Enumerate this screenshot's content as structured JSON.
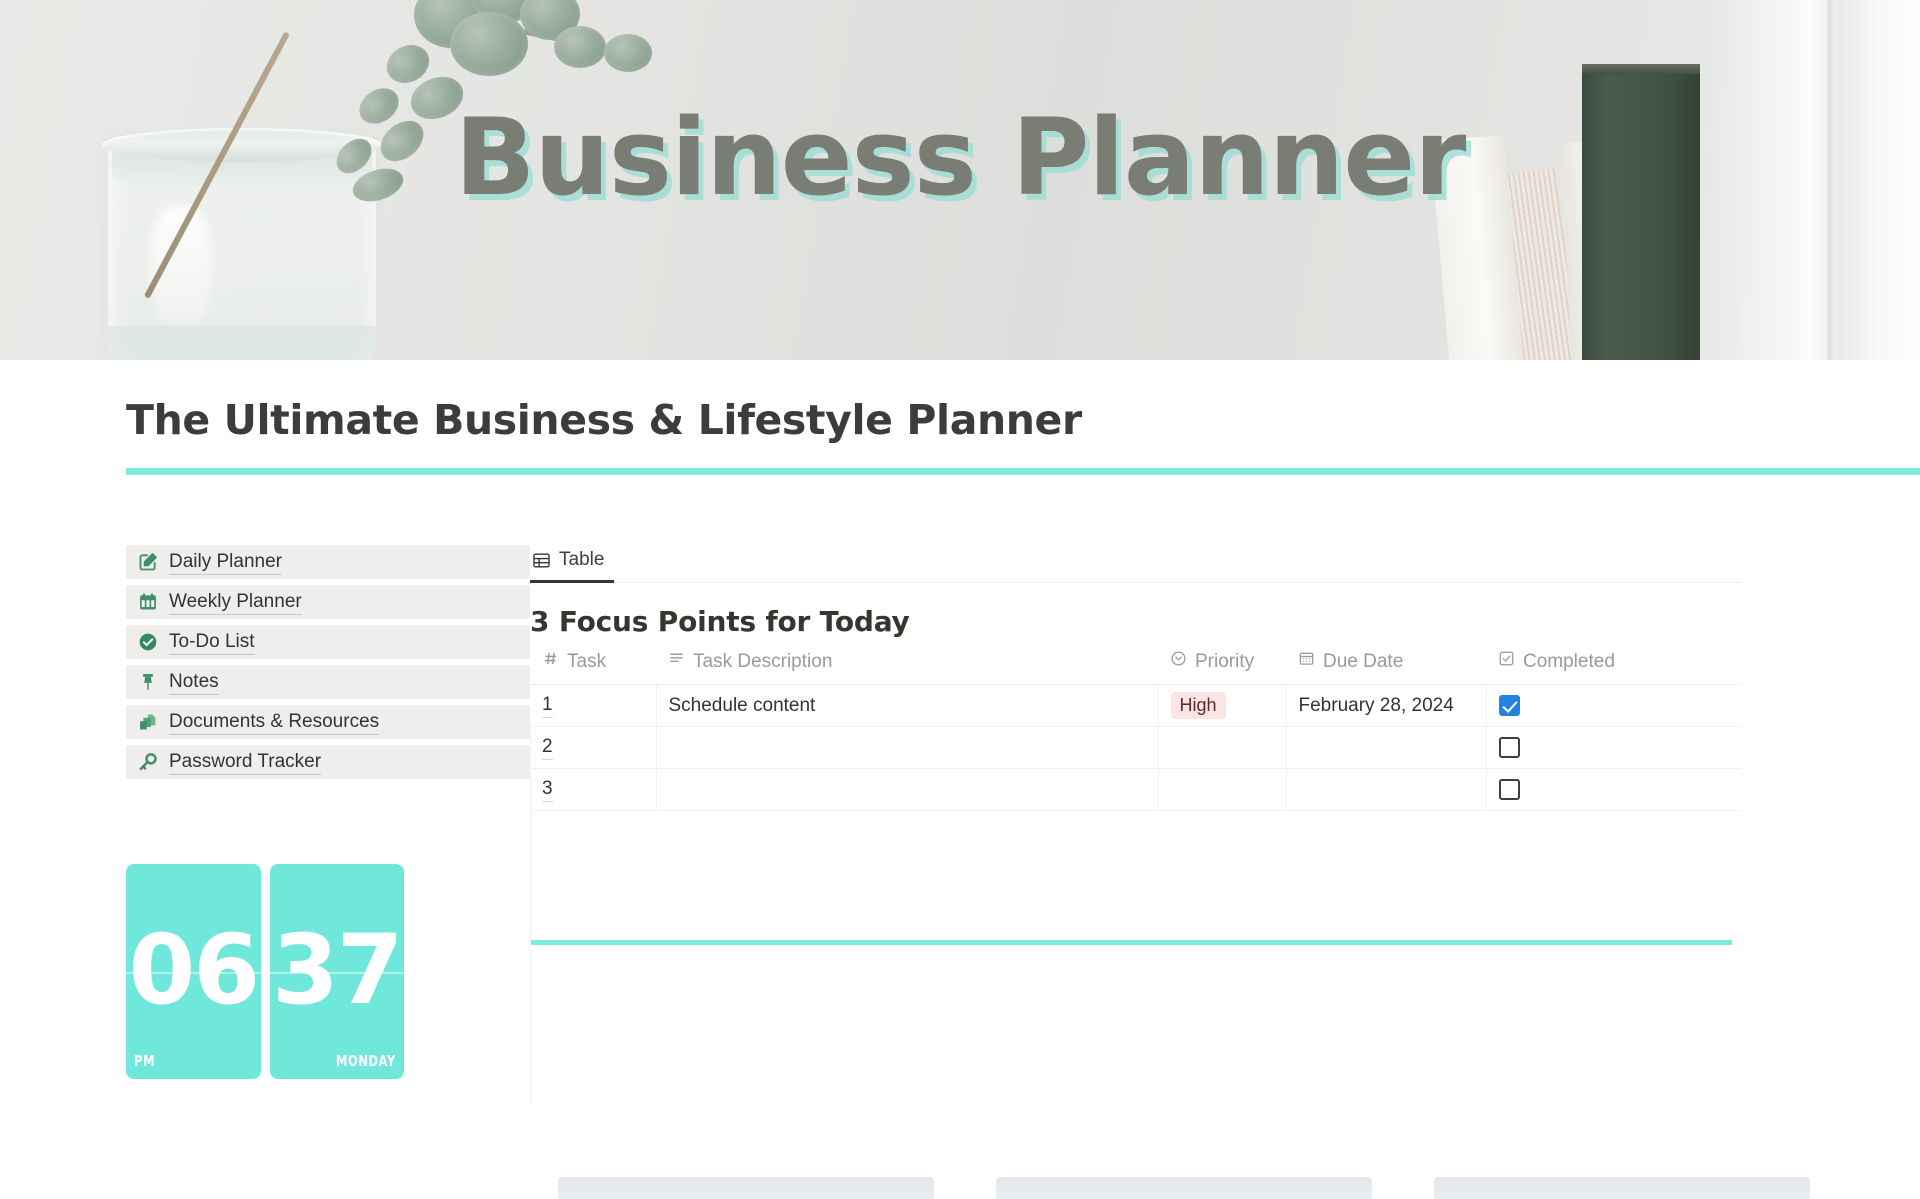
{
  "banner": {
    "title": "Business Planner",
    "title_color": "#797d73",
    "shadow_color": "#96dcd4"
  },
  "page": {
    "title": "The Ultimate Business & Lifestyle Planner",
    "accent_color": "#7cecdd"
  },
  "sidebar": {
    "items": [
      {
        "label": "Daily Planner",
        "icon": "pencil-square-icon"
      },
      {
        "label": "Weekly Planner",
        "icon": "calendar-icon"
      },
      {
        "label": "To-Do List",
        "icon": "check-circle-icon"
      },
      {
        "label": "Notes",
        "icon": "pushpin-icon"
      },
      {
        "label": "Documents & Resources",
        "icon": "documents-icon"
      },
      {
        "label": "Password Tracker",
        "icon": "key-icon"
      }
    ]
  },
  "clock": {
    "hours": "06",
    "minutes": "37",
    "meridiem": "PM",
    "weekday": "MONDAY",
    "color": "#70e7db"
  },
  "main": {
    "tabs": [
      {
        "label": "Table",
        "icon": "table-icon",
        "active": true
      }
    ],
    "database": {
      "title": "3 Focus Points for Today",
      "columns": [
        {
          "label": "Task",
          "icon": "hash-icon"
        },
        {
          "label": "Task Description",
          "icon": "text-lines-icon"
        },
        {
          "label": "Priority",
          "icon": "select-circle-icon"
        },
        {
          "label": "Due Date",
          "icon": "calendar-small-icon"
        },
        {
          "label": "Completed",
          "icon": "checkbox-icon"
        }
      ],
      "rows": [
        {
          "task": "1",
          "description": "Schedule content",
          "priority": "High",
          "priority_bg": "#fbe4e4",
          "priority_fg": "#5d2929",
          "due_date": "February 28, 2024",
          "completed": true
        },
        {
          "task": "2",
          "description": "",
          "priority": "",
          "due_date": "",
          "completed": false
        },
        {
          "task": "3",
          "description": "",
          "priority": "",
          "due_date": "",
          "completed": false
        }
      ]
    }
  }
}
